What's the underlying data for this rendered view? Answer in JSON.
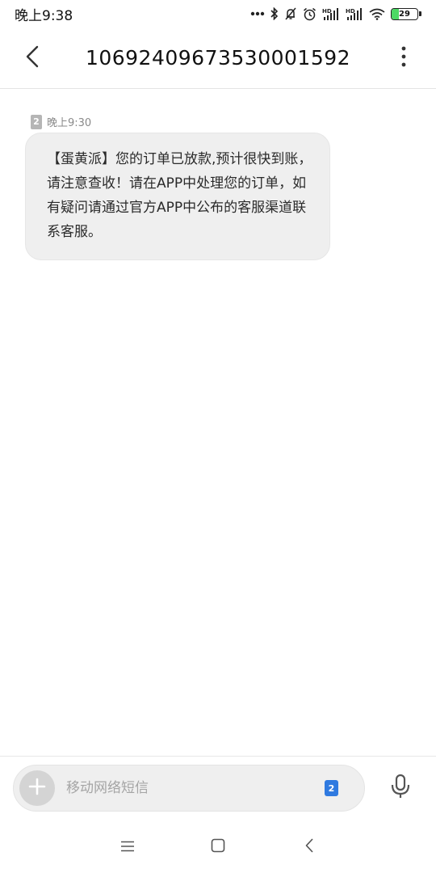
{
  "status_bar": {
    "time": "晚上9:38",
    "battery_level": "29",
    "battery_percent": 29,
    "battery_color": "#4cd964",
    "icons": [
      "more-dots-icon",
      "bluetooth-icon",
      "mute-icon",
      "alarm-icon",
      "hd-signal-1-icon",
      "hd-signal-2-icon",
      "wifi-icon",
      "battery-icon"
    ]
  },
  "header": {
    "title": "10692409673530001592",
    "back_icon": "back-arrow-icon",
    "more_icon": "more-vertical-icon"
  },
  "conversation": {
    "messages": [
      {
        "sim": "2",
        "time": "晚上9:30",
        "text": "【蛋黄派】您的订单已放款,预计很快到账，请注意查收！请在APP中处理您的订单，如有疑问请通过官方APP中公布的客服渠道联系客服。"
      }
    ]
  },
  "compose": {
    "placeholder": "移动网络短信",
    "sim_label": "2",
    "accent_color": "#2f7ae0"
  },
  "nav_bar": {
    "icons": [
      "menu-icon",
      "home-icon",
      "back-icon"
    ]
  }
}
